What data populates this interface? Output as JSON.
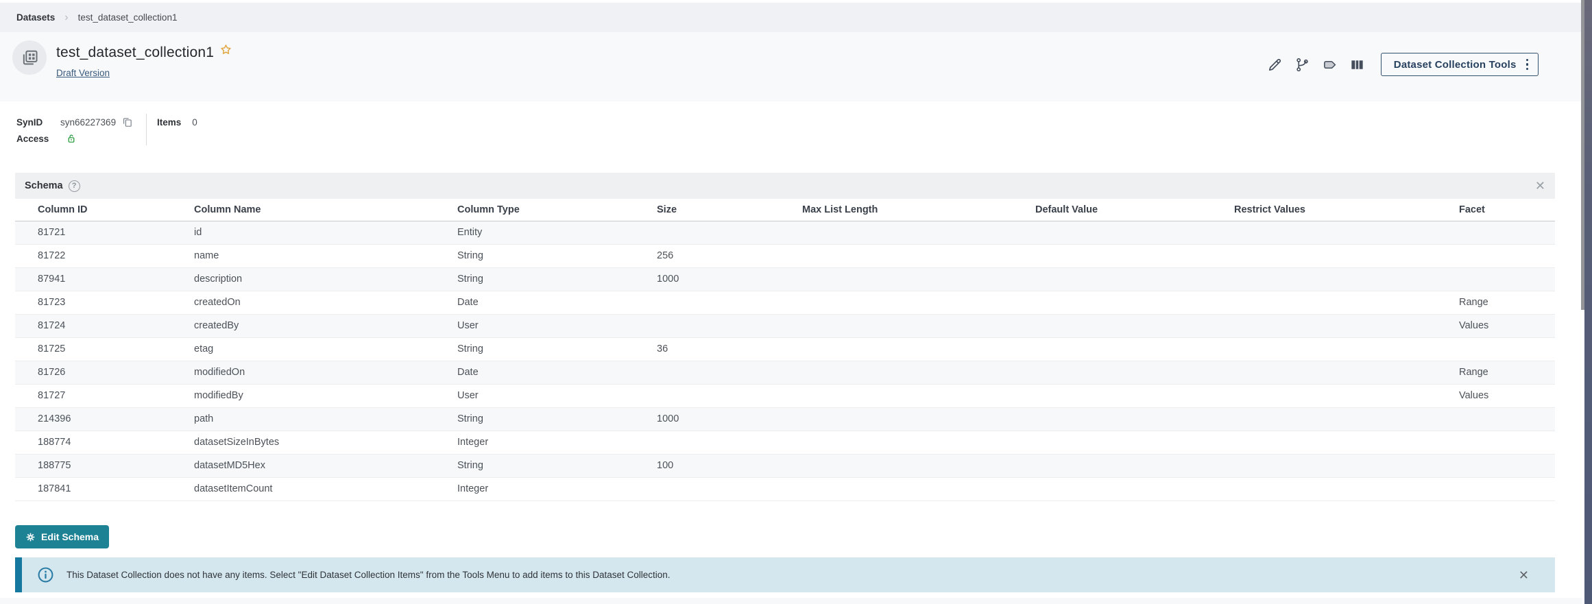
{
  "colors": {
    "accent_teal": "#1E8295",
    "banner_bg": "#D5E7EE",
    "banner_border": "#15789E",
    "access_green": "#2F9E44",
    "star_gold": "#E2A33B",
    "link_navy": "#395A7D"
  },
  "glyphs": {
    "close": "✕",
    "chevron": "›",
    "help": "?"
  },
  "breadcrumb": {
    "root": "Datasets",
    "current": "test_dataset_collection1"
  },
  "header": {
    "title": "test_dataset_collection1",
    "version_label": "Draft Version",
    "tools_button": "Dataset Collection Tools"
  },
  "meta": {
    "synid_label": "SynID",
    "synid_value": "syn66227369",
    "access_label": "Access",
    "items_label": "Items",
    "items_value": "0"
  },
  "schema": {
    "title": "Schema",
    "columns": [
      "Column ID",
      "Column Name",
      "Column Type",
      "Size",
      "Max List Length",
      "Default Value",
      "Restrict Values",
      "Facet"
    ],
    "rows": [
      {
        "id": "81721",
        "name": "id",
        "type": "Entity",
        "size": "",
        "max_list_length": "",
        "default_value": "",
        "restrict_values": "",
        "facet": ""
      },
      {
        "id": "81722",
        "name": "name",
        "type": "String",
        "size": "256",
        "max_list_length": "",
        "default_value": "",
        "restrict_values": "",
        "facet": ""
      },
      {
        "id": "87941",
        "name": "description",
        "type": "String",
        "size": "1000",
        "max_list_length": "",
        "default_value": "",
        "restrict_values": "",
        "facet": ""
      },
      {
        "id": "81723",
        "name": "createdOn",
        "type": "Date",
        "size": "",
        "max_list_length": "",
        "default_value": "",
        "restrict_values": "",
        "facet": "Range"
      },
      {
        "id": "81724",
        "name": "createdBy",
        "type": "User",
        "size": "",
        "max_list_length": "",
        "default_value": "",
        "restrict_values": "",
        "facet": "Values"
      },
      {
        "id": "81725",
        "name": "etag",
        "type": "String",
        "size": "36",
        "max_list_length": "",
        "default_value": "",
        "restrict_values": "",
        "facet": ""
      },
      {
        "id": "81726",
        "name": "modifiedOn",
        "type": "Date",
        "size": "",
        "max_list_length": "",
        "default_value": "",
        "restrict_values": "",
        "facet": "Range"
      },
      {
        "id": "81727",
        "name": "modifiedBy",
        "type": "User",
        "size": "",
        "max_list_length": "",
        "default_value": "",
        "restrict_values": "",
        "facet": "Values"
      },
      {
        "id": "214396",
        "name": "path",
        "type": "String",
        "size": "1000",
        "max_list_length": "",
        "default_value": "",
        "restrict_values": "",
        "facet": ""
      },
      {
        "id": "188774",
        "name": "datasetSizeInBytes",
        "type": "Integer",
        "size": "",
        "max_list_length": "",
        "default_value": "",
        "restrict_values": "",
        "facet": ""
      },
      {
        "id": "188775",
        "name": "datasetMD5Hex",
        "type": "String",
        "size": "100",
        "max_list_length": "",
        "default_value": "",
        "restrict_values": "",
        "facet": ""
      },
      {
        "id": "187841",
        "name": "datasetItemCount",
        "type": "Integer",
        "size": "",
        "max_list_length": "",
        "default_value": "",
        "restrict_values": "",
        "facet": ""
      }
    ]
  },
  "actions": {
    "edit_schema": "Edit Schema"
  },
  "banner": {
    "message": "This Dataset Collection does not have any items. Select \"Edit Dataset Collection Items\" from the Tools Menu to add items to this Dataset Collection."
  }
}
